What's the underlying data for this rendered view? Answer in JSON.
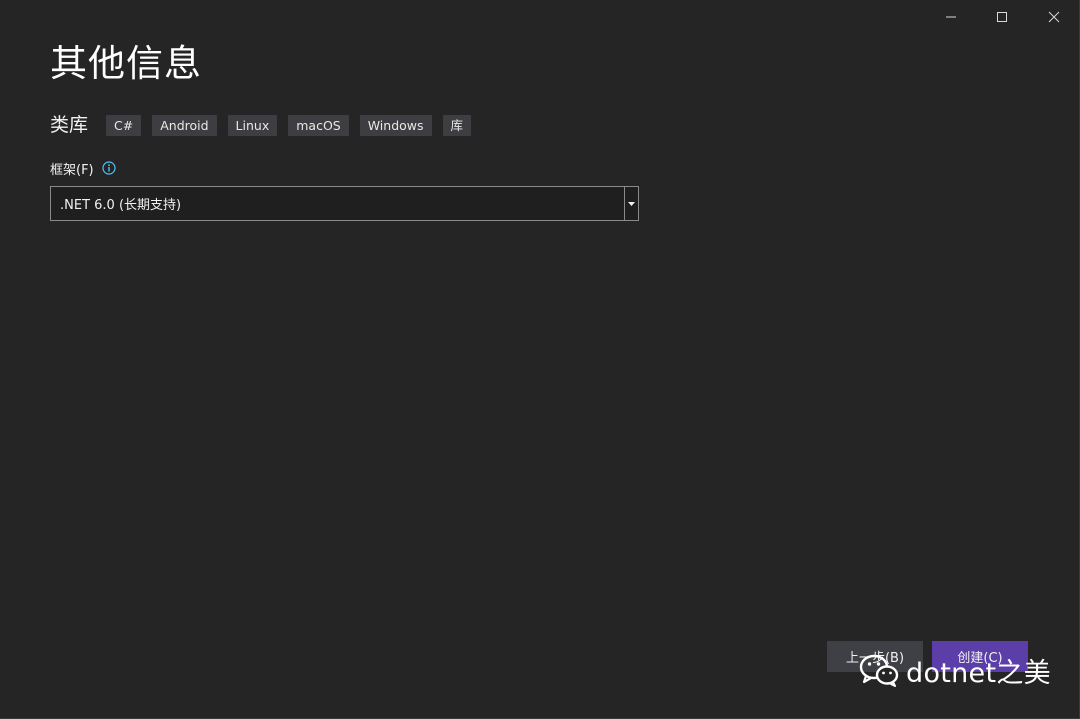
{
  "window": {
    "title": "其他信息"
  },
  "template": {
    "name": "类库",
    "tags": [
      "C#",
      "Android",
      "Linux",
      "macOS",
      "Windows",
      "库"
    ]
  },
  "framework": {
    "label": "框架(F)",
    "selected": ".NET 6.0 (长期支持)"
  },
  "footer": {
    "back_label": "上一步(B)",
    "create_label": "创建(C)"
  },
  "watermark": {
    "text": "dotnet之美"
  },
  "colors": {
    "background": "#252526",
    "create_button": "#5c3ea8",
    "back_button": "#3f3f46",
    "tag_background": "#3e3e42",
    "info_icon": "#4fc1ff"
  }
}
